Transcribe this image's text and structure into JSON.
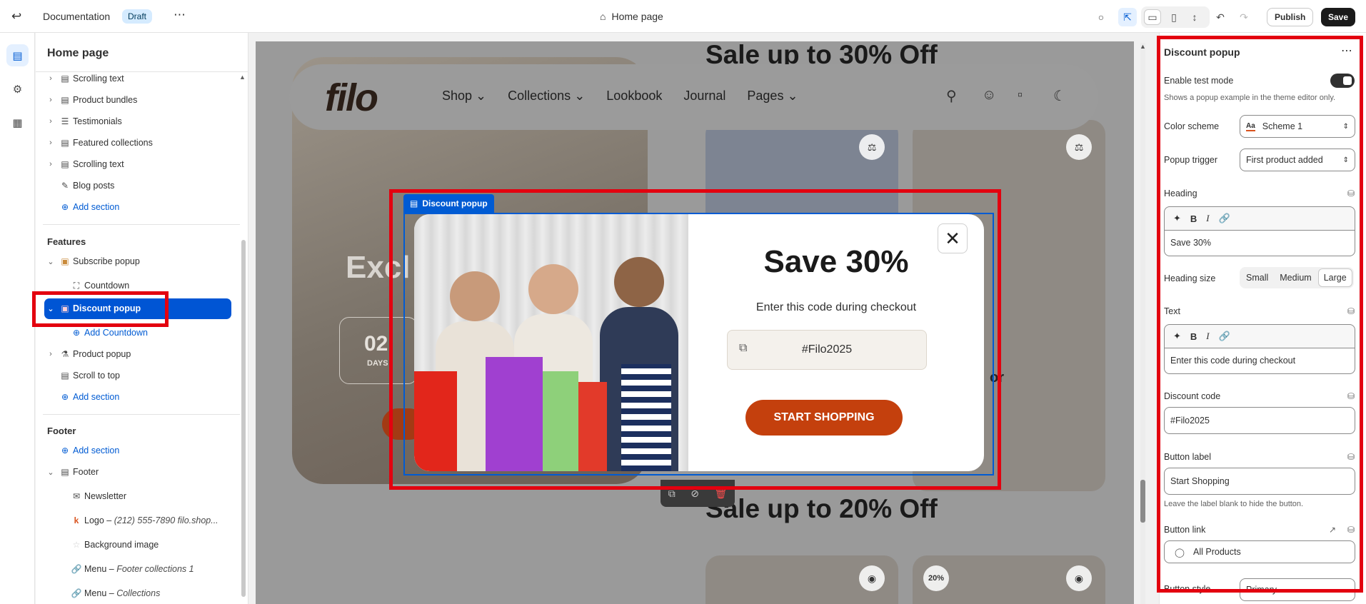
{
  "topbar": {
    "title": "Documentation",
    "badge": "Draft",
    "page": "Home page",
    "publish": "Publish",
    "save": "Save",
    "colors": {
      "save_bg": "#1a1a1a",
      "badge_bg": "#d5ebff"
    }
  },
  "left": {
    "title": "Home page",
    "sections": [
      {
        "label": "Scrolling text",
        "icon": "text-lines-icon"
      },
      {
        "label": "Product bundles",
        "icon": "text-lines-icon"
      },
      {
        "label": "Testimonials",
        "icon": "list-icon"
      },
      {
        "label": "Featured collections",
        "icon": "text-lines-icon"
      },
      {
        "label": "Scrolling text",
        "icon": "text-lines-icon"
      },
      {
        "label": "Blog posts",
        "icon": "edit-icon"
      }
    ],
    "add_section": "Add section",
    "features_heading": "Features",
    "subscribe_popup": "Subscribe popup",
    "countdown": "Countdown",
    "discount_popup": "Discount popup",
    "add_countdown": "Add Countdown",
    "product_popup": "Product popup",
    "scroll_to_top": "Scroll to top",
    "footer_heading": "Footer",
    "footer": "Footer",
    "newsletter": "Newsletter",
    "logo_label": "Logo",
    "logo_detail": "(212) 555-7890 filo.shop...",
    "background_image": "Background image",
    "menu_label": "Menu",
    "menu_1": "Footer collections 1",
    "menu_2": "Collections"
  },
  "preview": {
    "logo": "filo",
    "nav": [
      "Shop",
      "Collections",
      "Lookbook",
      "Journal",
      "Pages"
    ],
    "sale_top": "Sale up to 30% Off",
    "sale_bottom": "Sale up to 20% Off",
    "hero_text": "Excl",
    "countdown_num": "02",
    "countdown_unit": "DAYS",
    "partial_letter": "or",
    "discount_badge": "20%",
    "selection_tag": "Discount popup",
    "popup": {
      "heading": "Save 30%",
      "text": "Enter this code during checkout",
      "code": "#Filo2025",
      "button": "START SHOPPING"
    }
  },
  "right": {
    "title": "Discount popup",
    "test_mode_label": "Enable test mode",
    "test_mode_help": "Shows a popup example in the theme editor only.",
    "color_scheme_label": "Color scheme",
    "color_scheme_value": "Scheme 1",
    "color_scheme_icon": "Aa",
    "popup_trigger_label": "Popup trigger",
    "popup_trigger_value": "First product added",
    "heading_label": "Heading",
    "heading_value": "Save 30%",
    "heading_size_label": "Heading size",
    "sizes": [
      "Small",
      "Medium",
      "Large"
    ],
    "text_label": "Text",
    "text_value": "Enter this code during checkout",
    "discount_code_label": "Discount code",
    "discount_code_value": "#Filo2025",
    "button_label_label": "Button label",
    "button_label_value": "Start Shopping",
    "button_label_help": "Leave the label blank to hide the button.",
    "button_link_label": "Button link",
    "button_link_value": "All Products",
    "button_style_label": "Button style",
    "button_style_value": "Primary"
  }
}
